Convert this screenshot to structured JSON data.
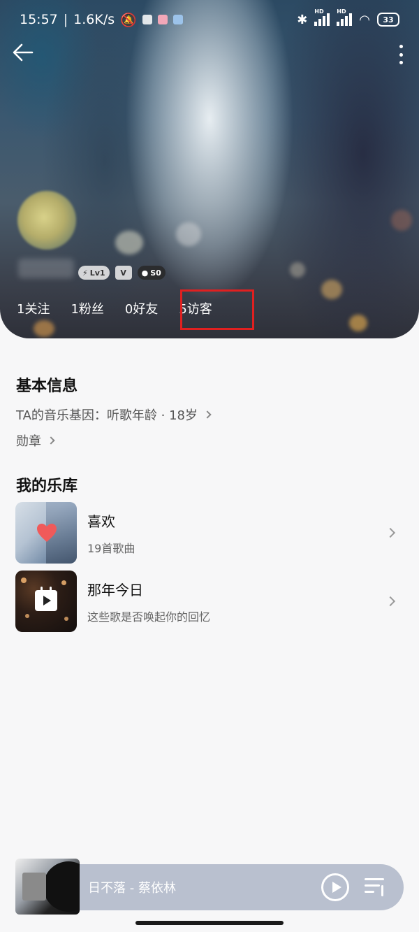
{
  "status": {
    "time": "15:57",
    "speed": "1.6K/s",
    "battery": "33",
    "hd": "HD"
  },
  "profile": {
    "badges": {
      "level": "Lv1",
      "vip": "V",
      "points": "S0"
    },
    "stats": {
      "follow": "1关注",
      "fans": "1粉丝",
      "friends": "0好友",
      "visitors": "5访客"
    }
  },
  "basic_info": {
    "title": "基本信息",
    "music_gene": "TA的音乐基因：听歌年龄 · 18岁",
    "medal": "勋章"
  },
  "library": {
    "title": "我的乐库",
    "items": [
      {
        "title": "喜欢",
        "subtitle": "19首歌曲",
        "icon": "heart-icon"
      },
      {
        "title": "那年今日",
        "subtitle": "这些歌是否唤起你的回忆",
        "icon": "calendar-play-icon"
      }
    ]
  },
  "player": {
    "song": "日不落 - 蔡依林"
  },
  "colors": {
    "highlight": "#e02020",
    "player_bg": "#b9c0cf"
  }
}
